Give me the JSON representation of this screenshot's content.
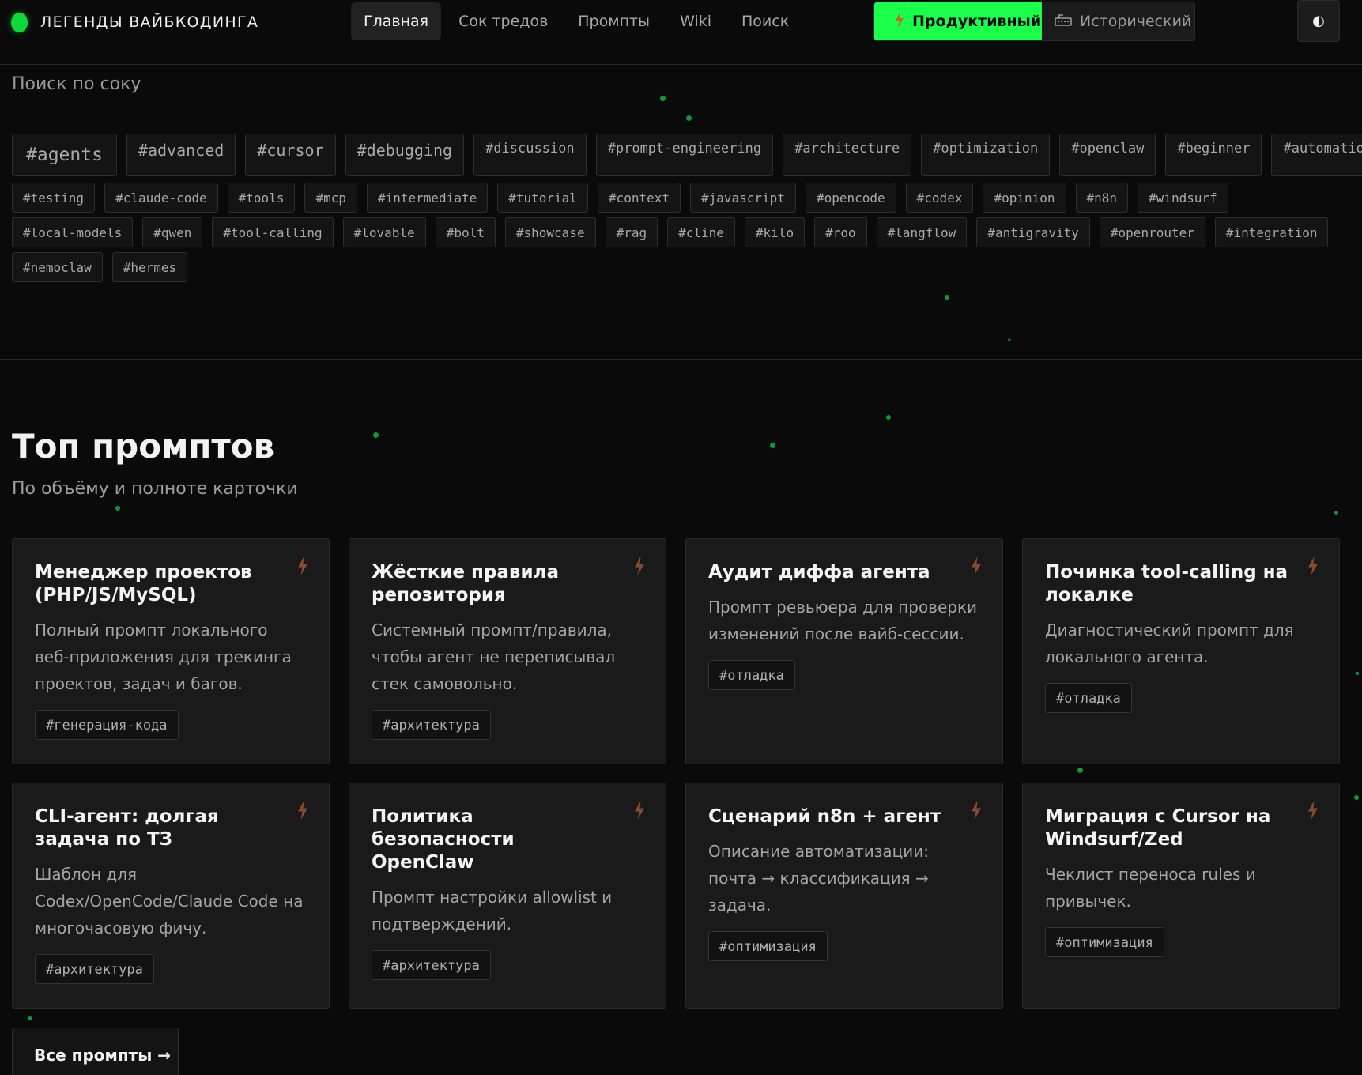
{
  "brand": {
    "name": "ЛЕГЕНДЫ ВАЙБКОДИНГА"
  },
  "nav": [
    {
      "label": "Главная",
      "active": true
    },
    {
      "label": "Сок тредов",
      "active": false
    },
    {
      "label": "Промпты",
      "active": false
    },
    {
      "label": "Wiki",
      "active": false
    },
    {
      "label": "Поиск",
      "active": false
    }
  ],
  "mode": {
    "productive": {
      "label": "Продуктивный",
      "icon": "lightning-icon",
      "selected": true
    },
    "historical": {
      "label": "Исторический",
      "icon": "keyboard-icon",
      "selected": false
    }
  },
  "theme_toggle": {
    "icon": "contrast-icon",
    "glyph": "◐"
  },
  "tag_cloud": {
    "heading": "Поиск по соку",
    "rows": [
      [
        {
          "t": "#agents",
          "s": 0
        },
        {
          "t": "#advanced",
          "s": 1
        },
        {
          "t": "#cursor",
          "s": 1
        },
        {
          "t": "#debugging",
          "s": 1
        },
        {
          "t": "#discussion",
          "s": 2
        },
        {
          "t": "#prompt-engineering",
          "s": 2
        },
        {
          "t": "#architecture",
          "s": 2
        },
        {
          "t": "#optimization",
          "s": 2
        },
        {
          "t": "#openclaw",
          "s": 2
        },
        {
          "t": "#beginner",
          "s": 2
        },
        {
          "t": "#automation",
          "s": 2
        }
      ],
      [
        {
          "t": "#testing",
          "s": 3
        },
        {
          "t": "#claude-code",
          "s": 3
        },
        {
          "t": "#tools",
          "s": 3
        },
        {
          "t": "#mcp",
          "s": 3
        },
        {
          "t": "#intermediate",
          "s": 3
        },
        {
          "t": "#tutorial",
          "s": 3
        },
        {
          "t": "#context",
          "s": 3
        },
        {
          "t": "#javascript",
          "s": 3
        },
        {
          "t": "#opencode",
          "s": 3
        },
        {
          "t": "#codex",
          "s": 3
        },
        {
          "t": "#opinion",
          "s": 3
        },
        {
          "t": "#n8n",
          "s": 3
        },
        {
          "t": "#windsurf",
          "s": 3
        }
      ],
      [
        {
          "t": "#local-models",
          "s": 3
        },
        {
          "t": "#qwen",
          "s": 3
        },
        {
          "t": "#tool-calling",
          "s": 3
        },
        {
          "t": "#lovable",
          "s": 3
        },
        {
          "t": "#bolt",
          "s": 3
        },
        {
          "t": "#showcase",
          "s": 3
        },
        {
          "t": "#rag",
          "s": 3
        },
        {
          "t": "#cline",
          "s": 3
        },
        {
          "t": "#kilo",
          "s": 3
        },
        {
          "t": "#roo",
          "s": 3
        },
        {
          "t": "#langflow",
          "s": 3
        },
        {
          "t": "#antigravity",
          "s": 3
        },
        {
          "t": "#openrouter",
          "s": 3
        },
        {
          "t": "#integration",
          "s": 3
        }
      ],
      [
        {
          "t": "#nemoclaw",
          "s": 3
        },
        {
          "t": "#hermes",
          "s": 3
        }
      ]
    ]
  },
  "prompts": {
    "title": "Топ промптов",
    "subtitle": "По объёму и полноте карточки",
    "cards": [
      {
        "title": "Менеджер проектов (PHP/JS/MySQL)",
        "desc": "Полный промпт локального веб-приложения для трекинга проектов, задач и багов.",
        "tag": "#генерация-кода"
      },
      {
        "title": "Жёсткие правила репозитория",
        "desc": "Системный промпт/правила, чтобы агент не переписывал стек самовольно.",
        "tag": "#архитектура"
      },
      {
        "title": "Аудит диффа агента",
        "desc": "Промпт ревьюера для проверки изменений после вайб-сессии.",
        "tag": "#отладка"
      },
      {
        "title": "Починка tool-calling на локалке",
        "desc": "Диагностический промпт для локального агента.",
        "tag": "#отладка"
      },
      {
        "title": "CLI-агент: долгая задача по ТЗ",
        "desc": "Шаблон для Codex/OpenCode/Claude Code на многочасовую фичу.",
        "tag": "#архитектура"
      },
      {
        "title": "Политика безопасности OpenClaw",
        "desc": "Промпт настройки allowlist и подтверждений.",
        "tag": "#архитектура"
      },
      {
        "title": "Сценарий n8n + агент",
        "desc": "Описание автоматизации: почта → классификация → задача.",
        "tag": "#оптимизация"
      },
      {
        "title": "Миграция с Cursor на Windsurf/Zed",
        "desc": "Чеклист переноса rules и привычек.",
        "tag": "#оптимизация"
      }
    ],
    "all_button": "Все промпты →"
  },
  "colors": {
    "accent": "#19ff4a",
    "background": "#0a0a0a",
    "card": "#1a1a1a",
    "bolt": "#8a4a2e"
  }
}
